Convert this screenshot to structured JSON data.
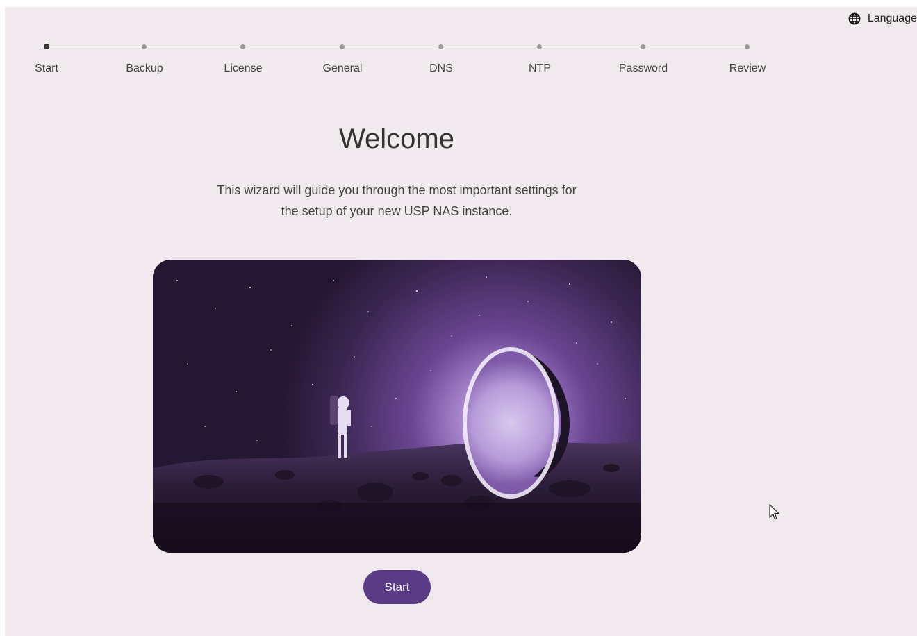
{
  "language": {
    "label": "Language",
    "icon": "globe-icon"
  },
  "stepper": {
    "steps": [
      {
        "label": "Start",
        "active": true
      },
      {
        "label": "Backup",
        "active": false
      },
      {
        "label": "License",
        "active": false
      },
      {
        "label": "General",
        "active": false
      },
      {
        "label": "DNS",
        "active": false
      },
      {
        "label": "NTP",
        "active": false
      },
      {
        "label": "Password",
        "active": false
      },
      {
        "label": "Review",
        "active": false
      }
    ]
  },
  "main": {
    "title": "Welcome",
    "description_line1": "This wizard will guide you through the most important settings for",
    "description_line2": "the setup of your new USP NAS instance.",
    "start_label": "Start"
  },
  "colors": {
    "background": "#f0e9ee",
    "accent": "#5b3a86"
  }
}
